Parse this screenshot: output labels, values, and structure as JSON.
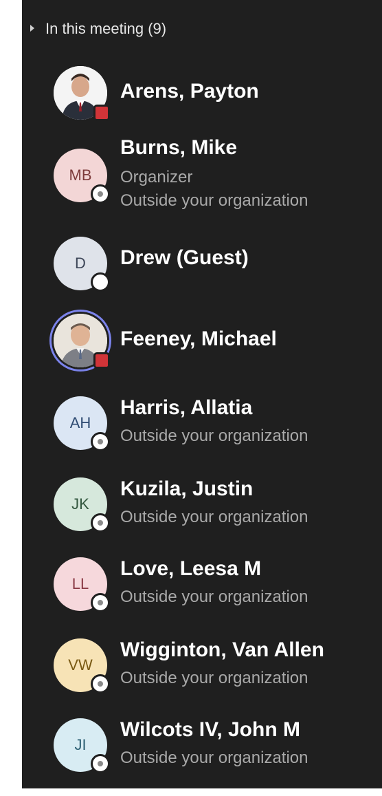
{
  "section": {
    "title": "In this meeting (9)"
  },
  "participants": [
    {
      "name": "Arens, Payton",
      "status": "mic-off",
      "avatar": "photo"
    },
    {
      "name": "Burns, Mike",
      "initials": "MB",
      "role": "Organizer",
      "org": "Outside your organization",
      "avatar_bg": "#f3d6d6",
      "initials_color": "#7d3b3b"
    },
    {
      "name": "Drew (Guest)",
      "initials": "D",
      "avatar_bg": "#dfe3ea",
      "initials_color": "#3d4658"
    },
    {
      "name": "Feeney, Michael",
      "status": "mic-off",
      "avatar": "photo",
      "speaking": true
    },
    {
      "name": "Harris, Allatia",
      "initials": "AH",
      "org": "Outside your organization",
      "avatar_bg": "#dbe6f4",
      "initials_color": "#2e4b72"
    },
    {
      "name": "Kuzila, Justin",
      "initials": "JK",
      "org": "Outside your organization",
      "avatar_bg": "#d6e8dc",
      "initials_color": "#33573f"
    },
    {
      "name": "Love, Leesa M",
      "initials": "LL",
      "org": "Outside your organization",
      "avatar_bg": "#f6d8dc",
      "initials_color": "#8a3a45"
    },
    {
      "name": "Wigginton, Van Allen",
      "initials": "VW",
      "org": "Outside your organization",
      "avatar_bg": "#f7e3b6",
      "initials_color": "#7a5a14"
    },
    {
      "name": "Wilcots IV, John M",
      "initials": "JI",
      "org": "Outside your organization",
      "avatar_bg": "#d8ecf3",
      "initials_color": "#2f6174"
    }
  ],
  "colors": {
    "panel_bg": "#1f1f1f",
    "speaking_ring": "#7b83eb",
    "mic_off": "#d13438"
  }
}
